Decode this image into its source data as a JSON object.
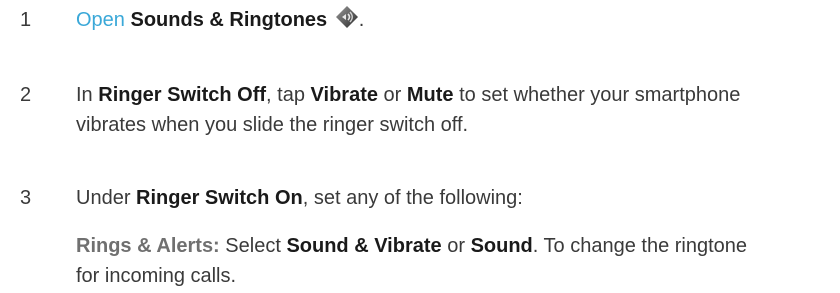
{
  "steps": [
    {
      "number": "1",
      "link": "Open",
      "app": "Sounds & Ringtones",
      "icon": "sounds-ringtones-icon",
      "end": "."
    },
    {
      "number": "2",
      "t1": "In ",
      "b1": "Ringer Switch Off",
      "t2": ", tap ",
      "b2": "Vibrate",
      "t3": " or ",
      "b3": "Mute",
      "t4": " to set whether your smartphone vibrates when you slide the ringer switch off."
    },
    {
      "number": "3",
      "t1": "Under ",
      "b1": "Ringer Switch On",
      "t2": ", set any of the following:"
    }
  ],
  "sub": {
    "label": "Rings & Alerts:",
    "t1": " Select ",
    "b1": "Sound & Vibrate",
    "t2": " or ",
    "b2": "Sound",
    "t3": ". To change the ringtone for incoming calls."
  },
  "colors": {
    "link": "#3aa8d8",
    "text": "#3a3a3a",
    "bold": "#1a1a1a",
    "sublabel": "#707070"
  }
}
